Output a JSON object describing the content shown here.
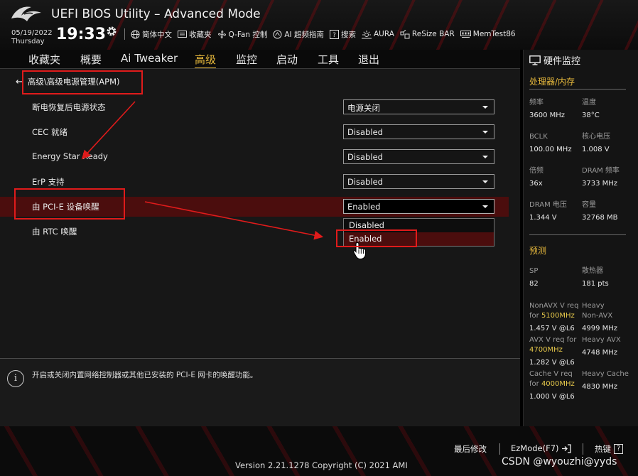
{
  "window": {
    "title": "UEFI BIOS Utility – Advanced Mode"
  },
  "header": {
    "date": "05/19/2022",
    "day": "Thursday",
    "time": "19:33",
    "toolbar": [
      {
        "label": "简体中文",
        "icon": "globe-icon"
      },
      {
        "label": "收藏夹",
        "icon": "favorites-icon"
      },
      {
        "label": "Q-Fan 控制",
        "icon": "fan-icon"
      },
      {
        "label": "AI 超频指南",
        "icon": "ai-oc-icon"
      },
      {
        "label": "搜索",
        "icon": "search-help-icon"
      },
      {
        "label": "AURA",
        "icon": "aura-icon"
      },
      {
        "label": "ReSize BAR",
        "icon": "resize-bar-icon"
      },
      {
        "label": "MemTest86",
        "icon": "memtest-icon"
      }
    ]
  },
  "tabs": [
    {
      "label": "收藏夹",
      "active": false
    },
    {
      "label": "概要",
      "active": false
    },
    {
      "label": "Ai Tweaker",
      "active": false
    },
    {
      "label": "高级",
      "active": true
    },
    {
      "label": "监控",
      "active": false
    },
    {
      "label": "启动",
      "active": false
    },
    {
      "label": "工具",
      "active": false
    },
    {
      "label": "退出",
      "active": false
    }
  ],
  "breadcrumb": "高级\\高级电源管理(APM)",
  "settings": [
    {
      "label": "断电恢复后电源状态",
      "value": "电源关闭"
    },
    {
      "label": "CEC 就绪",
      "value": "Disabled"
    },
    {
      "label": "Energy Star Ready",
      "value": "Disabled"
    },
    {
      "label": "ErP 支持",
      "value": "Disabled"
    },
    {
      "label": "由 PCI-E 设备唤醒",
      "value": "Enabled"
    },
    {
      "label": "由 RTC 唤醒",
      "value": ""
    }
  ],
  "dropdown": {
    "options": [
      "Disabled",
      "Enabled"
    ],
    "selected": "Enabled"
  },
  "help_text": "开启或关闭内置网络控制器或其他已安装的 PCI-E 网卡的唤醒功能。",
  "hardware_monitor": {
    "title": "硬件监控",
    "cpu_section": "处理器/内存",
    "cpu_items": [
      {
        "key": "频率",
        "value": "3600 MHz"
      },
      {
        "key": "温度",
        "value": "38°C"
      },
      {
        "key": "BCLK",
        "value": "100.00 MHz"
      },
      {
        "key": "核心电压",
        "value": "1.008 V"
      },
      {
        "key": "倍频",
        "value": "36x"
      },
      {
        "key": "DRAM 频率",
        "value": "3733 MHz"
      },
      {
        "key": "DRAM 电压",
        "value": "1.344 V"
      },
      {
        "key": "容量",
        "value": "32768 MB"
      }
    ],
    "prediction_section": "预测",
    "prediction_items": [
      {
        "key": "SP",
        "value": "82"
      },
      {
        "key": "散热器",
        "value": "181 pts"
      },
      {
        "key_a": "NonAVX V req",
        "key_b": "for ",
        "key_hl": "5100MHz",
        "value": "1.457 V @L6"
      },
      {
        "key_a": "Heavy",
        "key_b": "Non-AVX",
        "key_hl": "",
        "value": "4999 MHz"
      },
      {
        "key_a": "AVX V req    for",
        "key_b": "",
        "key_hl": "4700MHz",
        "value": "1.282 V @L6"
      },
      {
        "key_a": "Heavy AVX",
        "key_b": "",
        "key_hl": "",
        "value": "4748 MHz"
      },
      {
        "key_a": "Cache V req",
        "key_b": "for ",
        "key_hl": "4000MHz",
        "value": "1.000 V @L6"
      },
      {
        "key_a": "Heavy Cache",
        "key_b": "",
        "key_hl": "",
        "value": "4830 MHz"
      }
    ]
  },
  "footer": {
    "last_modified": "最后修改",
    "ezmode": "EzMode(F7)",
    "hotkeys": "热键",
    "hotkeys_box": "?",
    "version": "Version 2.21.1278 Copyright (C) 2021 AMI"
  },
  "watermark": "CSDN @wyouzhi@yyds",
  "colors": {
    "accent_gold": "#e6b83c",
    "highlight_row": "#4b0d0d",
    "annotation_red": "#e01b1b"
  }
}
